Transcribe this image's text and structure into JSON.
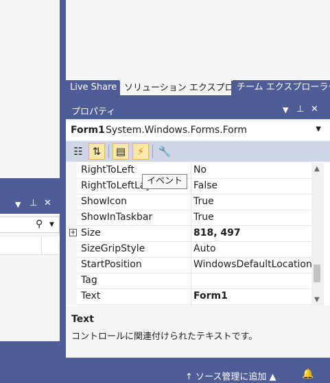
{
  "tabs": {
    "live_share": "Live Share",
    "solution_explorer": "ソリューション エクスプロ...",
    "team_explorer": "チーム エクスプローラー"
  },
  "properties_panel": {
    "title": "プロパティ",
    "object_name": "Form1",
    "object_type": "System.Windows.Forms.Form",
    "tooltip": "イベント",
    "rows": [
      {
        "name": "RightToLeft",
        "value": "No",
        "bold": false,
        "expandable": false
      },
      {
        "name": "RightToLeftLayout",
        "value": "False",
        "bold": false,
        "expandable": false
      },
      {
        "name": "ShowIcon",
        "value": "True",
        "bold": false,
        "expandable": false
      },
      {
        "name": "ShowInTaskbar",
        "value": "True",
        "bold": false,
        "expandable": false
      },
      {
        "name": "Size",
        "value": "818, 497",
        "bold": true,
        "expandable": true
      },
      {
        "name": "SizeGripStyle",
        "value": "Auto",
        "bold": false,
        "expandable": false
      },
      {
        "name": "StartPosition",
        "value": "WindowsDefaultLocation",
        "bold": false,
        "expandable": false
      },
      {
        "name": "Tag",
        "value": "",
        "bold": false,
        "expandable": false
      },
      {
        "name": "Text",
        "value": "Form1",
        "bold": true,
        "expandable": false
      }
    ],
    "description_title": "Text",
    "description_text": "コントロールに関連付けられたテキストです。"
  },
  "status_bar": {
    "add_to_source_control": "↑ ソース管理に追加 ▲"
  },
  "icons": {
    "dropdown": "▾",
    "pin": "⊥",
    "close": "✕",
    "search": "⚲",
    "bell": "🔔",
    "bolt": "⚡",
    "wrench": "🔧"
  },
  "colors": {
    "accent_bar": "#4e5d96",
    "panel_bg": "#f5f5f5",
    "toolbar_bg": "#cfd6e6",
    "active_button": "#fbe8b0"
  }
}
